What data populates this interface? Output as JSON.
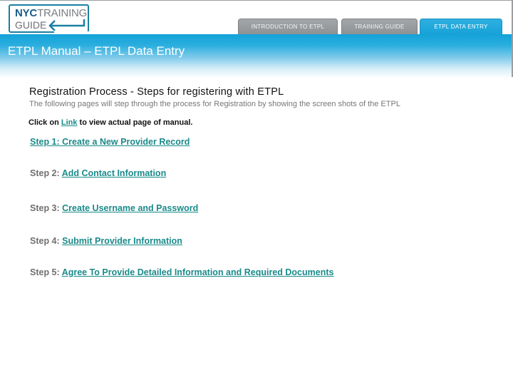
{
  "logo": {
    "line1_bold": "NYC",
    "line1_light": "TRAINING",
    "line2": "GUIDE",
    "icon": "arrow-left-icon"
  },
  "tabs": [
    {
      "label": "INTRODUCTION TO ETPL",
      "active": false
    },
    {
      "label": "TRAINING GUIDE",
      "active": false
    },
    {
      "label": "ETPL DATA ENTRY",
      "active": true
    }
  ],
  "header": {
    "title": "ETPL Manual – ETPL Data Entry"
  },
  "content": {
    "section_title": "Registration Process - Steps for registering with ETPL",
    "section_desc": "The following pages will step through the process for Registration by showing the screen shots of the ETPL",
    "click_note": {
      "prefix": "Click on ",
      "link": "Link",
      "suffix": " to view actual page of manual."
    },
    "steps": [
      {
        "prefix": "",
        "link": "Step 1: Create a New Provider Record"
      },
      {
        "prefix": "Step 2: ",
        "link": "Add Contact Information"
      },
      {
        "prefix": "Step 3: ",
        "link": "Create Username and Password"
      },
      {
        "prefix": "Step 4: ",
        "link": "Submit Provider Information"
      },
      {
        "prefix": "Step 5: ",
        "link": "Agree To Provide Detailed Information and Required Documents"
      }
    ]
  },
  "colors": {
    "brand_blue": "#13a2d8",
    "logo_border": "#1a7fa3",
    "link_teal": "#1a8a8a",
    "tab_gray": "#999c9f"
  }
}
